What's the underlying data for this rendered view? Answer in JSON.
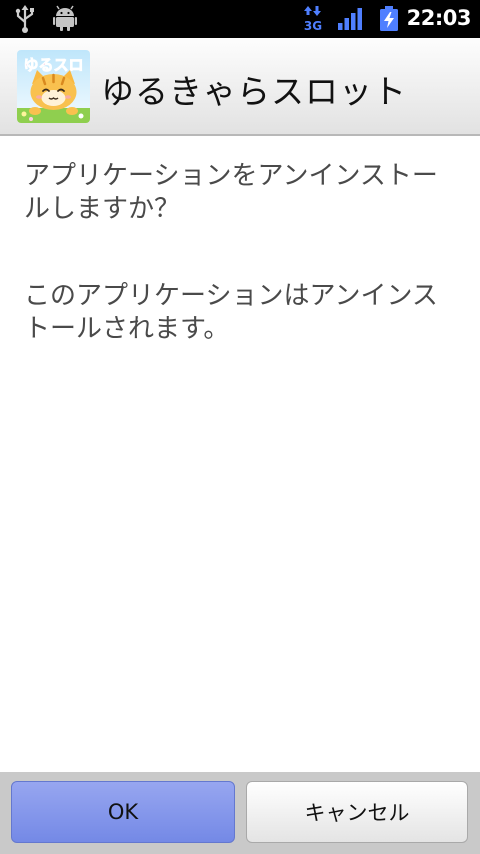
{
  "status_bar": {
    "time": "22:03",
    "network_label": "3G",
    "icons": [
      "usb-icon",
      "debug-icon",
      "network-3g-icon",
      "signal-icon",
      "battery-charging-icon"
    ]
  },
  "header": {
    "app_name": "ゆるきゃらスロット",
    "icon_text": "ゆるスロ"
  },
  "message": {
    "question_line1": "アプリケーションをアンインストー",
    "question_line2": "ルしますか？",
    "info_line1": "このアプリケーションはアンインス",
    "info_line2": "トールされます。"
  },
  "buttons": {
    "ok_label": "OK",
    "cancel_label": "キャンセル"
  },
  "colors": {
    "ok_button": "#7e91ea",
    "status_bar": "#000000",
    "network_icon": "#4f7fff"
  }
}
